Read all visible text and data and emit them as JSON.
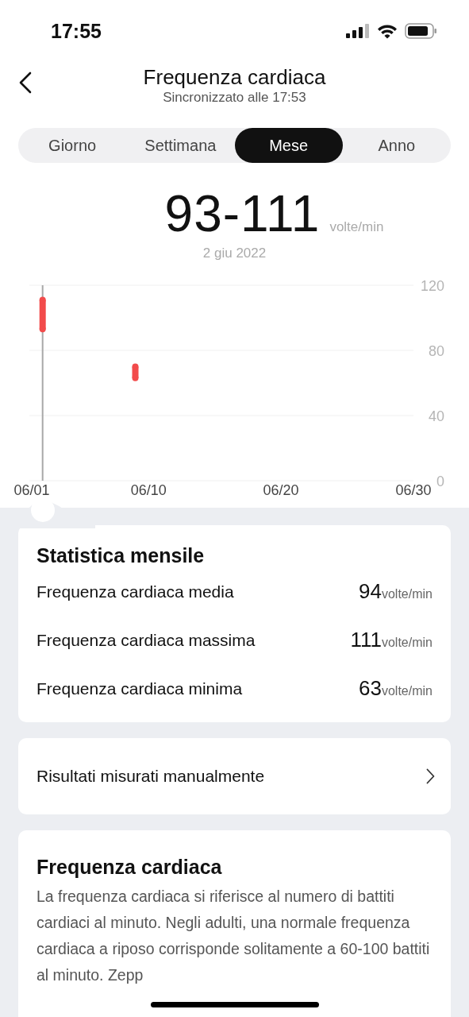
{
  "status_bar": {
    "time": "17:55"
  },
  "header": {
    "title": "Frequenza cardiaca",
    "subtitle": "Sincronizzato alle 17:53"
  },
  "tabs": [
    {
      "label": "Giorno",
      "selected": false
    },
    {
      "label": "Settimana",
      "selected": false
    },
    {
      "label": "Mese",
      "selected": true
    },
    {
      "label": "Anno",
      "selected": false
    }
  ],
  "summary": {
    "value": "93-111",
    "unit": "volte/min",
    "date": "2 giu 2022"
  },
  "chart": {
    "chart_data": {
      "type": "scatter",
      "categories": [
        "06/01",
        null,
        null,
        null,
        null,
        null,
        null,
        null,
        null,
        "06/10",
        null,
        null,
        null,
        null,
        null,
        null,
        null,
        null,
        null,
        "06/20",
        null,
        null,
        null,
        null,
        null,
        null,
        null,
        null,
        null,
        "06/30"
      ],
      "series": [
        {
          "color": "#f24b4b",
          "values": [
            null,
            111,
            null,
            null,
            null,
            null,
            null,
            null,
            70,
            null,
            null,
            null,
            null,
            null,
            null,
            null,
            null,
            null,
            null,
            null,
            null,
            null,
            null,
            null,
            null,
            null,
            null,
            null,
            null,
            null
          ]
        },
        {
          "color": "#f24b4b",
          "values": [
            null,
            93,
            null,
            null,
            null,
            null,
            null,
            null,
            63,
            null,
            null,
            null,
            null,
            null,
            null,
            null,
            null,
            null,
            null,
            null,
            null,
            null,
            null,
            null,
            null,
            null,
            null,
            null,
            null,
            null
          ]
        }
      ],
      "ylim": [
        0,
        120
      ],
      "yticks": [
        0,
        40,
        80,
        120
      ]
    }
  },
  "stats": {
    "title": "Statistica mensile",
    "rows": [
      {
        "label": "Frequenza cardiaca media",
        "value": "94",
        "unit": "volte/min"
      },
      {
        "label": "Frequenza cardiaca massima",
        "value": "111",
        "unit": "volte/min"
      },
      {
        "label": "Frequenza cardiaca minima",
        "value": "63",
        "unit": "volte/min"
      }
    ]
  },
  "manual_results": {
    "label": "Risultati misurati manualmente"
  },
  "info": {
    "title": "Frequenza cardiaca",
    "text": "La frequenza cardiaca si riferisce al numero di battiti cardiaci al minuto. Negli adulti, una normale frequenza cardiaca a riposo corrisponde solitamente a 60-100 battiti al minuto. Zepp"
  }
}
